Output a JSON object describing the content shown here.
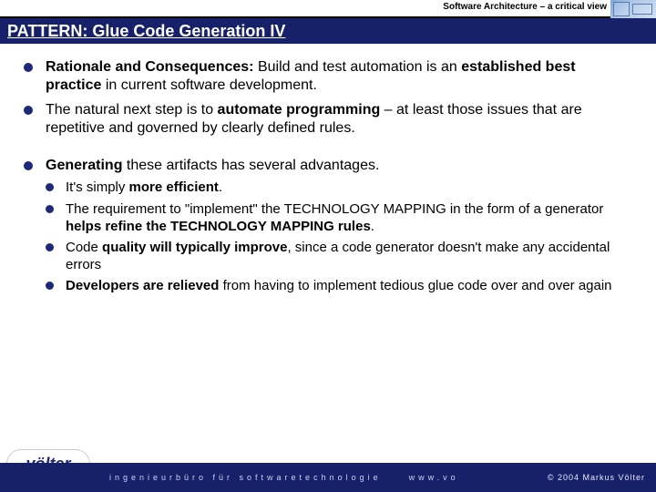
{
  "header": {
    "series_title": "Software Architecture – a critical view",
    "slide_title": "PATTERN: Glue Code Generation IV"
  },
  "bullets": {
    "b1_lead": "Rationale and Consequences:",
    "b1_rest": " Build and test automation is an ",
    "b1_bold2": "established best practice",
    "b1_tail": " in current software development.",
    "b2_a": "The natural next step is to ",
    "b2_bold": "automate programming",
    "b2_b": " – at least those issues that are repetitive and governed by clearly defined rules.",
    "b3_bold": "Generating",
    "b3_rest": " these artifacts has several advantages.",
    "s1_a": "It's simply ",
    "s1_bold": "more efficient",
    "s1_b": ".",
    "s2_a": "The requirement to \"implement\" the TECHNOLOGY MAPPING in the form of a generator ",
    "s2_bold": "helps refine the TECHNOLOGY MAPPING rules",
    "s2_b": ".",
    "s3_a": "Code ",
    "s3_bold": "quality will typically improve",
    "s3_b": ", since a code generator doesn't make any accidental errors",
    "s4_bold": "Developers are relieved",
    "s4_b": " from having to implement tedious glue code over and over again"
  },
  "footer": {
    "logo": "völter",
    "tagline": "ingenieurbüro für softwaretechnologie",
    "url": "www.vo",
    "copyright": "© 2004  Markus Völter"
  }
}
